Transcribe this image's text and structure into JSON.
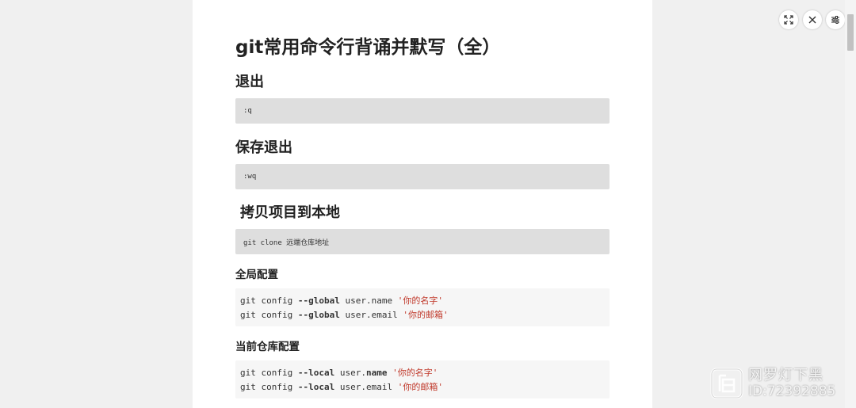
{
  "article": {
    "title": "git常用命令行背诵并默写（全）",
    "sections": [
      {
        "heading": "退出",
        "code": ":q"
      },
      {
        "heading": "保存退出",
        "code": ":wq"
      },
      {
        "heading": "拷贝项目到本地",
        "code": "git clone 远端仓库地址"
      }
    ],
    "global_config": {
      "heading": "全局配置",
      "lines": [
        {
          "cmd": "git config ",
          "flag": "--global",
          "key": " user.name ",
          "value": "'你的名字'"
        },
        {
          "cmd": "git config ",
          "flag": "--global",
          "key": " user.email ",
          "value": "'你的邮箱'"
        }
      ]
    },
    "local_config": {
      "heading": "当前仓库配置",
      "lines": [
        {
          "cmd": "git config ",
          "flag": "--local",
          "key_prefix": " user.",
          "key_bold": "name",
          "key_suffix": " ",
          "value": "'你的名字'"
        },
        {
          "cmd": "git config ",
          "flag": "--local",
          "key_prefix": " user.",
          "key_bold": "email",
          "key_suffix": " ",
          "value": "'你的邮箱'"
        }
      ]
    }
  },
  "toolbar": {
    "fullscreen_icon": "expand-icon",
    "close_icon": "close-icon",
    "settings_icon": "sliders-icon"
  },
  "watermark": {
    "name": "网罗灯下黑",
    "id": "ID:72392885"
  },
  "colors": {
    "background": "#f0f0f0",
    "page": "#ffffff",
    "code_bg": "#dedede",
    "string": "#c0392b"
  }
}
